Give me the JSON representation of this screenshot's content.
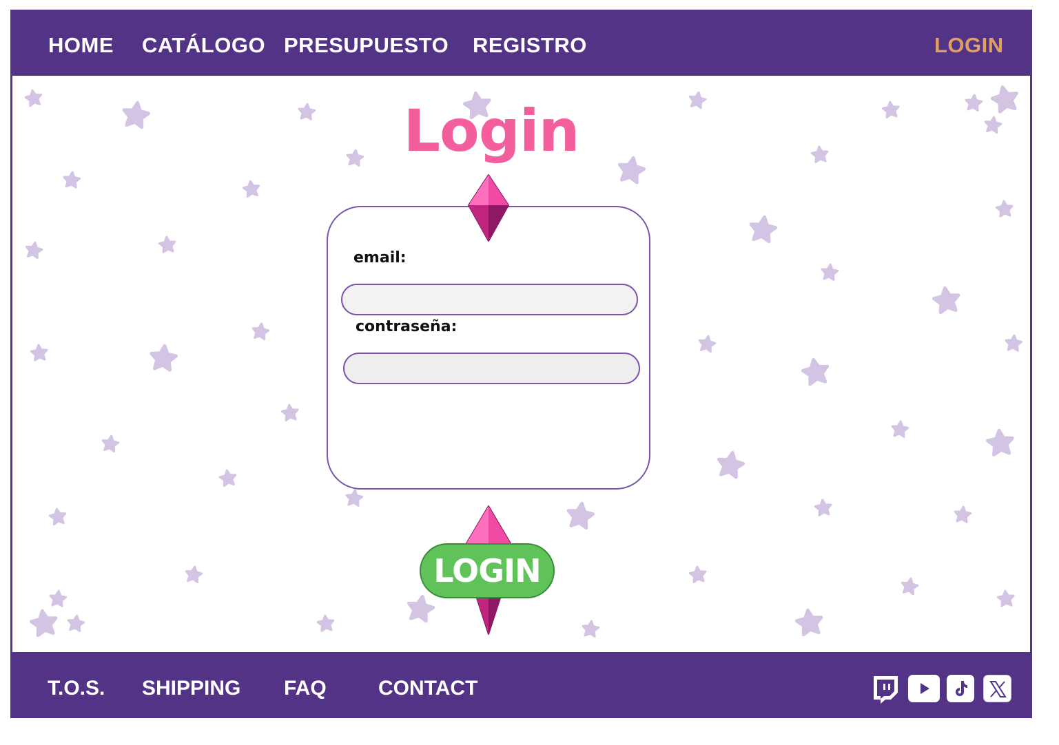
{
  "nav": {
    "home": "HOME",
    "catalog": "CATÁLOGO",
    "budget": "PRESUPUESTO",
    "register": "REGISTRO",
    "login": "LOGIN"
  },
  "page": {
    "title": "Login"
  },
  "form": {
    "email_label": "email:",
    "email_value": "",
    "password_label": "contraseña:",
    "password_value": "",
    "submit_label": "LOGIN"
  },
  "footer": {
    "tos": "T.O.S.",
    "shipping": "SHIPPING",
    "faq": "FAQ",
    "contact": "CONTACT",
    "social_icons": [
      "twitch-icon",
      "youtube-icon",
      "tiktok-icon",
      "x-icon"
    ]
  },
  "colors": {
    "brand_purple": "#523385",
    "nav_active": "#e0a063",
    "title_pink": "#f45e9c",
    "star_lilac": "#d3c4e3",
    "gem_magenta": "#d42f8f",
    "button_green": "#5fc35a"
  }
}
